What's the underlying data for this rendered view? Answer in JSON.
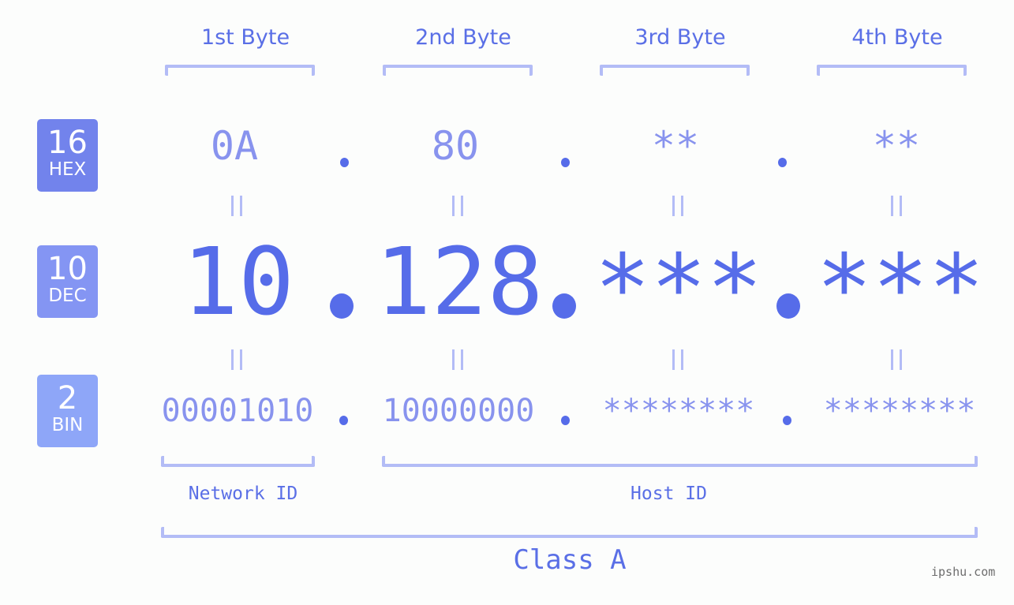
{
  "bytes": {
    "labels": [
      "1st Byte",
      "2nd Byte",
      "3rd Byte",
      "4th Byte"
    ]
  },
  "badges": {
    "hex": {
      "num": "16",
      "label": "HEX"
    },
    "dec": {
      "num": "10",
      "label": "DEC"
    },
    "bin": {
      "num": "2",
      "label": "BIN"
    }
  },
  "address": {
    "hex": [
      "0A",
      "80",
      "**",
      "**"
    ],
    "dec": [
      "10",
      "128",
      "***",
      "***"
    ],
    "bin": [
      "00001010",
      "10000000",
      "********",
      "********"
    ],
    "separator": "."
  },
  "groups": {
    "network": "Network ID",
    "host": "Host ID",
    "class": "Class A"
  },
  "watermark": "ipshu.com",
  "colors": {
    "accent": "#566ce9",
    "light_accent": "#8893ee",
    "bracket": "#b3bcf6",
    "hex_badge": "#7283ec",
    "dec_badge": "#8495f3",
    "bin_badge": "#8ea6f8"
  }
}
